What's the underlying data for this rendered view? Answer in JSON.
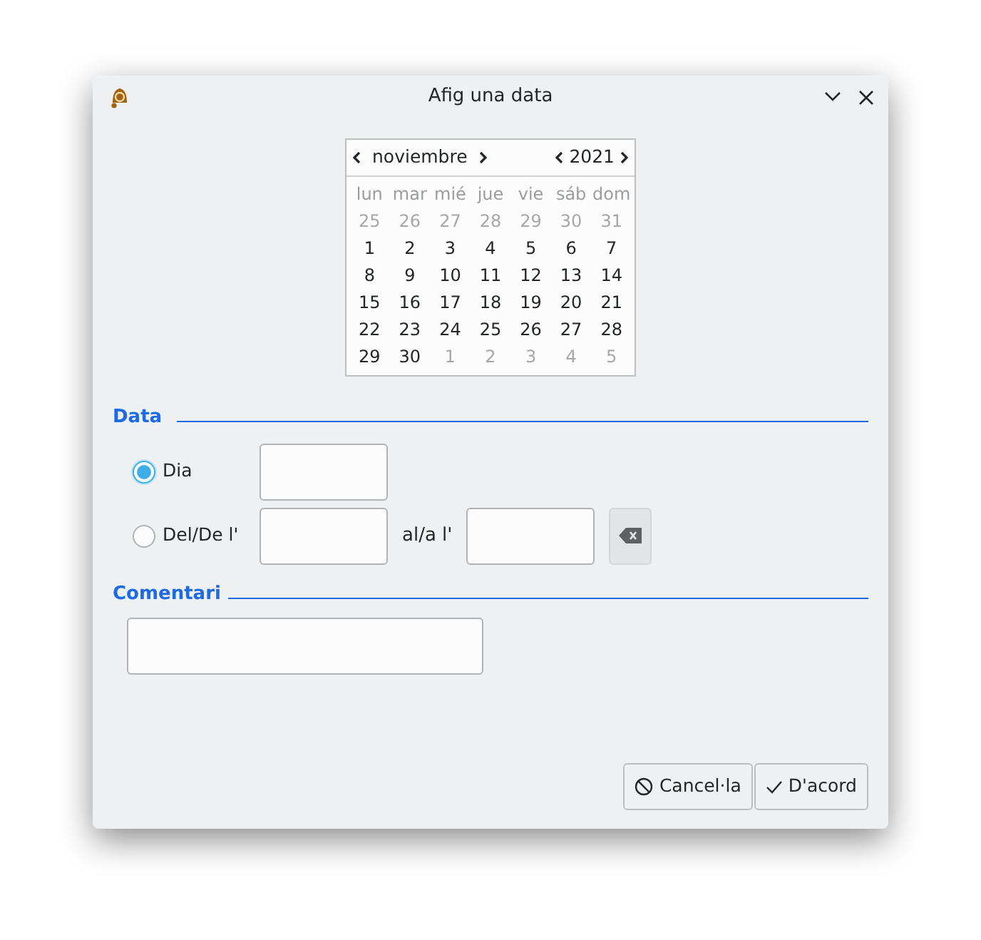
{
  "window": {
    "title": "Afig una data"
  },
  "calendar": {
    "month": "noviembre",
    "year": "2021",
    "weekdays": [
      "lun",
      "mar",
      "mié",
      "jue",
      "vie",
      "sáb",
      "dom"
    ],
    "days": [
      {
        "label": "25",
        "in_month": false
      },
      {
        "label": "26",
        "in_month": false
      },
      {
        "label": "27",
        "in_month": false
      },
      {
        "label": "28",
        "in_month": false
      },
      {
        "label": "29",
        "in_month": false
      },
      {
        "label": "30",
        "in_month": false
      },
      {
        "label": "31",
        "in_month": false
      },
      {
        "label": "1",
        "in_month": true
      },
      {
        "label": "2",
        "in_month": true
      },
      {
        "label": "3",
        "in_month": true
      },
      {
        "label": "4",
        "in_month": true
      },
      {
        "label": "5",
        "in_month": true
      },
      {
        "label": "6",
        "in_month": true
      },
      {
        "label": "7",
        "in_month": true
      },
      {
        "label": "8",
        "in_month": true
      },
      {
        "label": "9",
        "in_month": true
      },
      {
        "label": "10",
        "in_month": true
      },
      {
        "label": "11",
        "in_month": true
      },
      {
        "label": "12",
        "in_month": true
      },
      {
        "label": "13",
        "in_month": true
      },
      {
        "label": "14",
        "in_month": true
      },
      {
        "label": "15",
        "in_month": true
      },
      {
        "label": "16",
        "in_month": true
      },
      {
        "label": "17",
        "in_month": true
      },
      {
        "label": "18",
        "in_month": true
      },
      {
        "label": "19",
        "in_month": true
      },
      {
        "label": "20",
        "in_month": true
      },
      {
        "label": "21",
        "in_month": true
      },
      {
        "label": "22",
        "in_month": true
      },
      {
        "label": "23",
        "in_month": true
      },
      {
        "label": "24",
        "in_month": true
      },
      {
        "label": "25",
        "in_month": true
      },
      {
        "label": "26",
        "in_month": true
      },
      {
        "label": "27",
        "in_month": true
      },
      {
        "label": "28",
        "in_month": true
      },
      {
        "label": "29",
        "in_month": true
      },
      {
        "label": "30",
        "in_month": true
      },
      {
        "label": "1",
        "in_month": false
      },
      {
        "label": "2",
        "in_month": false
      },
      {
        "label": "3",
        "in_month": false
      },
      {
        "label": "4",
        "in_month": false
      },
      {
        "label": "5",
        "in_month": false
      }
    ]
  },
  "date_section": {
    "title": "Data",
    "options": [
      {
        "label": "Dia",
        "selected": true
      },
      {
        "label": "Del/De l'",
        "selected": false
      }
    ],
    "to_label": "al/a l'"
  },
  "comment_section": {
    "title": "Comentari"
  },
  "buttons": [
    {
      "label": "Cancel·la",
      "kind": "cancel"
    },
    {
      "label": "D'acord",
      "kind": "ok"
    }
  ]
}
